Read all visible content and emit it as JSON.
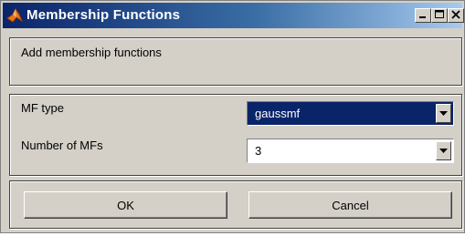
{
  "window": {
    "title": "Membership Functions",
    "icon": "matlab-logo-icon"
  },
  "info": {
    "message": "Add membership functions"
  },
  "form": {
    "mf_type_label": "MF type",
    "mf_type_value": "gaussmf",
    "num_mfs_label": "Number of MFs",
    "num_mfs_value": "3"
  },
  "buttons": {
    "ok": "OK",
    "cancel": "Cancel"
  },
  "colors": {
    "selection": "#0a246a",
    "face": "#d4d0c8"
  }
}
